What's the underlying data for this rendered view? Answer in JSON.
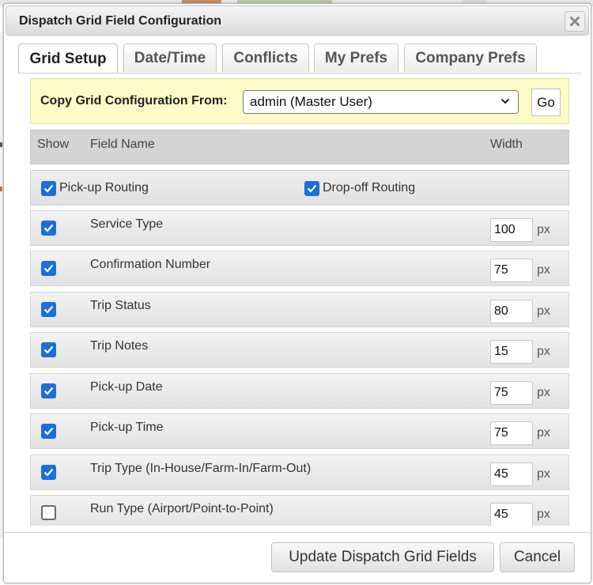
{
  "dialog": {
    "title": "Dispatch Grid Field Configuration",
    "close_icon": "close-icon"
  },
  "tabs": [
    {
      "label": "Grid Setup",
      "active": true
    },
    {
      "label": "Date/Time",
      "active": false
    },
    {
      "label": "Conflicts",
      "active": false
    },
    {
      "label": "My Prefs",
      "active": false
    },
    {
      "label": "Company Prefs",
      "active": false
    }
  ],
  "copy": {
    "label": "Copy Grid Configuration From:",
    "selected": "admin (Master User)",
    "go_label": "Go"
  },
  "grid_header": {
    "show": "Show",
    "field_name": "Field Name",
    "width": "Width"
  },
  "routing": {
    "pickup": {
      "label": "Pick-up Routing",
      "checked": true
    },
    "dropoff": {
      "label": "Drop-off Routing",
      "checked": true
    }
  },
  "fields": [
    {
      "name": "Service Type",
      "checked": true,
      "width": "100",
      "unit": "px"
    },
    {
      "name": "Confirmation Number",
      "checked": true,
      "width": "75",
      "unit": "px"
    },
    {
      "name": "Trip Status",
      "checked": true,
      "width": "80",
      "unit": "px"
    },
    {
      "name": "Trip Notes",
      "checked": true,
      "width": "15",
      "unit": "px"
    },
    {
      "name": "Pick-up Date",
      "checked": true,
      "width": "75",
      "unit": "px"
    },
    {
      "name": "Pick-up Time",
      "checked": true,
      "width": "75",
      "unit": "px"
    },
    {
      "name": "Trip Type (In-House/Farm-In/Farm-Out)",
      "checked": true,
      "width": "45",
      "unit": "px"
    },
    {
      "name": "Run Type (Airport/Point-to-Point)",
      "checked": false,
      "width": "45",
      "unit": "px"
    }
  ],
  "footer": {
    "update_label": "Update Dispatch Grid Fields",
    "cancel_label": "Cancel"
  },
  "colors": {
    "checkbox_checked": "#1a6fdb",
    "copy_bar_bg": "#fdfcc8",
    "header_bg": "#d4d4d4"
  }
}
